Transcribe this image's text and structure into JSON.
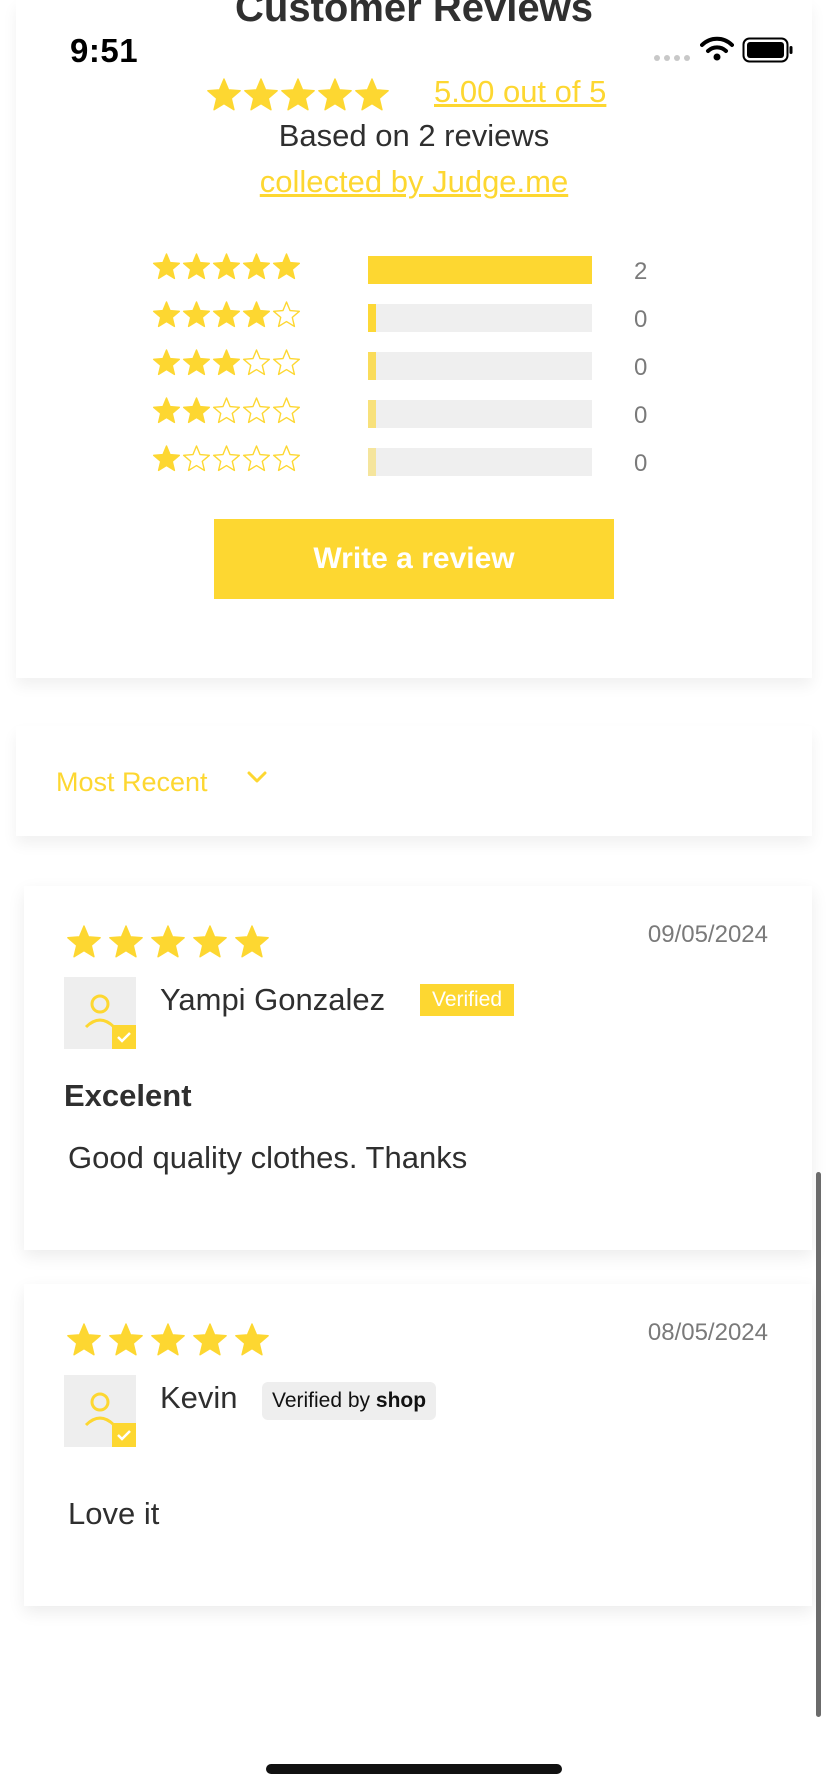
{
  "status_bar": {
    "time": "9:51",
    "icons": [
      "signal-icon",
      "wifi-icon",
      "battery-icon"
    ]
  },
  "summary": {
    "title": "Customer Reviews",
    "average_rating": 5,
    "rating_text": "5.00 out of 5",
    "based_on": "Based on 2 reviews",
    "collected_by": "collected by Judge.me",
    "histogram": [
      {
        "stars": 5,
        "count": "2",
        "fraction": 1.0
      },
      {
        "stars": 4,
        "count": "0",
        "fraction": 0
      },
      {
        "stars": 3,
        "count": "0",
        "fraction": 0
      },
      {
        "stars": 2,
        "count": "0",
        "fraction": 0
      },
      {
        "stars": 1,
        "count": "0",
        "fraction": 0
      }
    ],
    "write_review_label": "Write a review"
  },
  "sort": {
    "selected": "Most Recent"
  },
  "reviews": [
    {
      "rating": 5,
      "date": "09/05/2024",
      "name": "Yampi Gonzalez",
      "badge": "Verified",
      "title": "Excelent",
      "body": "Good quality clothes. Thanks"
    },
    {
      "rating": 5,
      "date": "08/05/2024",
      "name": "Kevin",
      "badge_prefix": "Verified by",
      "badge_brand": "shop",
      "title": "",
      "body": "Love it"
    }
  ],
  "colors": {
    "accent": "#fdd731",
    "text": "#2f2f2f",
    "muted": "#7a7a7a",
    "track": "#efefef"
  }
}
